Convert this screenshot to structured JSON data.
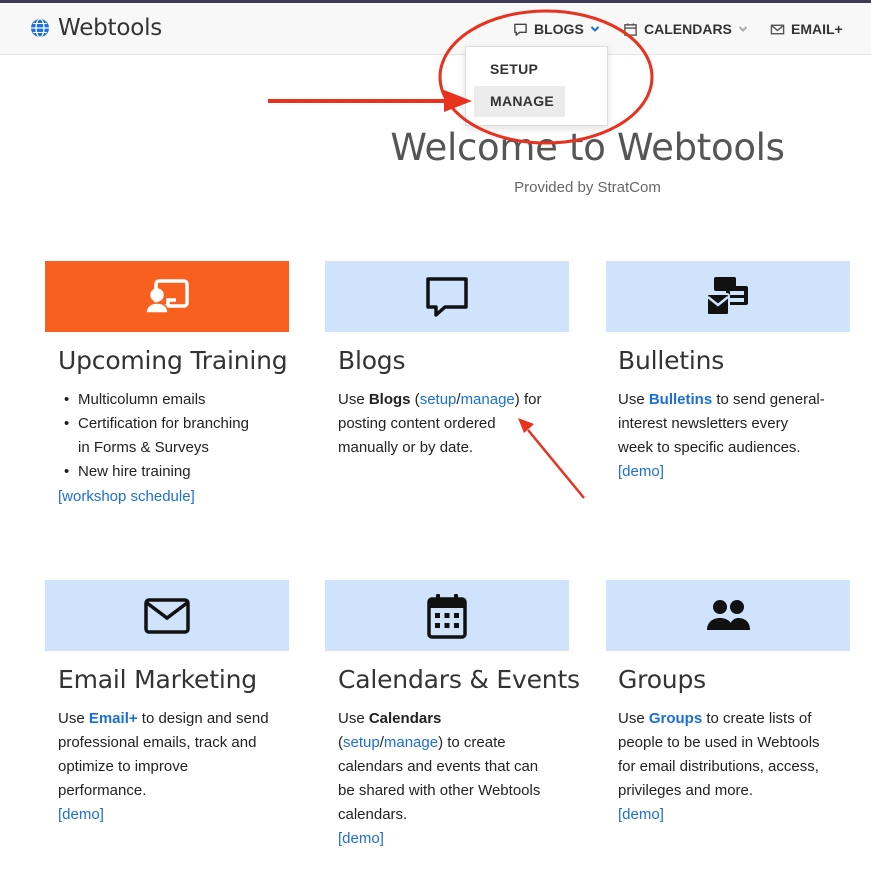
{
  "brand": {
    "name": "Webtools",
    "icon": "globe-icon"
  },
  "nav": {
    "blogs": {
      "label": "BLOGS",
      "icon": "comment-icon"
    },
    "calendars": {
      "label": "CALENDARS",
      "icon": "calendar-icon"
    },
    "email": {
      "label": "EMAIL+",
      "icon": "envelope-icon"
    }
  },
  "dropdown": {
    "items": [
      {
        "label": "SETUP"
      },
      {
        "label": "MANAGE"
      }
    ]
  },
  "hero": {
    "title": "Welcome to Webtools",
    "subtitle": "Provided by StratCom"
  },
  "cards": {
    "training": {
      "icon": "screen-user-icon",
      "title": "Upcoming Training",
      "items": [
        "Multicolumn emails",
        "Certification for branching",
        "in Forms & Surveys",
        "New hire training"
      ],
      "link": "[workshop schedule]"
    },
    "blogs": {
      "icon": "comment-icon",
      "title": "Blogs",
      "t1": "Use ",
      "strong": "Blogs",
      "t2": " (",
      "setup": "setup",
      "slash": "/",
      "manage": "manage",
      "t3": ") for",
      "line2": "posting content ordered",
      "line3": "manually or by date."
    },
    "bulletins": {
      "icon": "mail-bulk-icon",
      "title": "Bulletins",
      "t1": "Use ",
      "strong": "Bulletins",
      "t2": " to send general-",
      "line2": "interest newsletters every",
      "line3": "week to specific audiences.",
      "demo": "[demo]"
    },
    "email": {
      "icon": "envelope-icon",
      "title": "Email Marketing",
      "t1": "Use ",
      "strong": "Email+",
      "t2": " to design and send",
      "line2": "professional emails, track and",
      "line3": "optimize to improve",
      "line4": "performance.",
      "demo": "[demo]"
    },
    "calendars": {
      "icon": "calendar-icon",
      "title": "Calendars & Events",
      "t1": "Use ",
      "strong": "Calendars",
      "l2a": "(",
      "setup": "setup",
      "slash": "/",
      "manage": "manage",
      "l2b": ") to create",
      "line3": "calendars and events that can",
      "line4": "be shared with other Webtools",
      "line5": "calendars.",
      "demo": "[demo]"
    },
    "groups": {
      "icon": "users-icon",
      "title": "Groups",
      "t1": "Use ",
      "strong": "Groups",
      "t2": " to create lists of",
      "line2": "people to be used in Webtools",
      "line3": "for email distributions, access,",
      "line4": "privileges and more.",
      "demo": "[demo]"
    }
  },
  "colors": {
    "accent": "#1b6fd8",
    "orange": "#f86020",
    "light_blue": "#cfe4fc",
    "annotation_red": "#e8321e"
  }
}
